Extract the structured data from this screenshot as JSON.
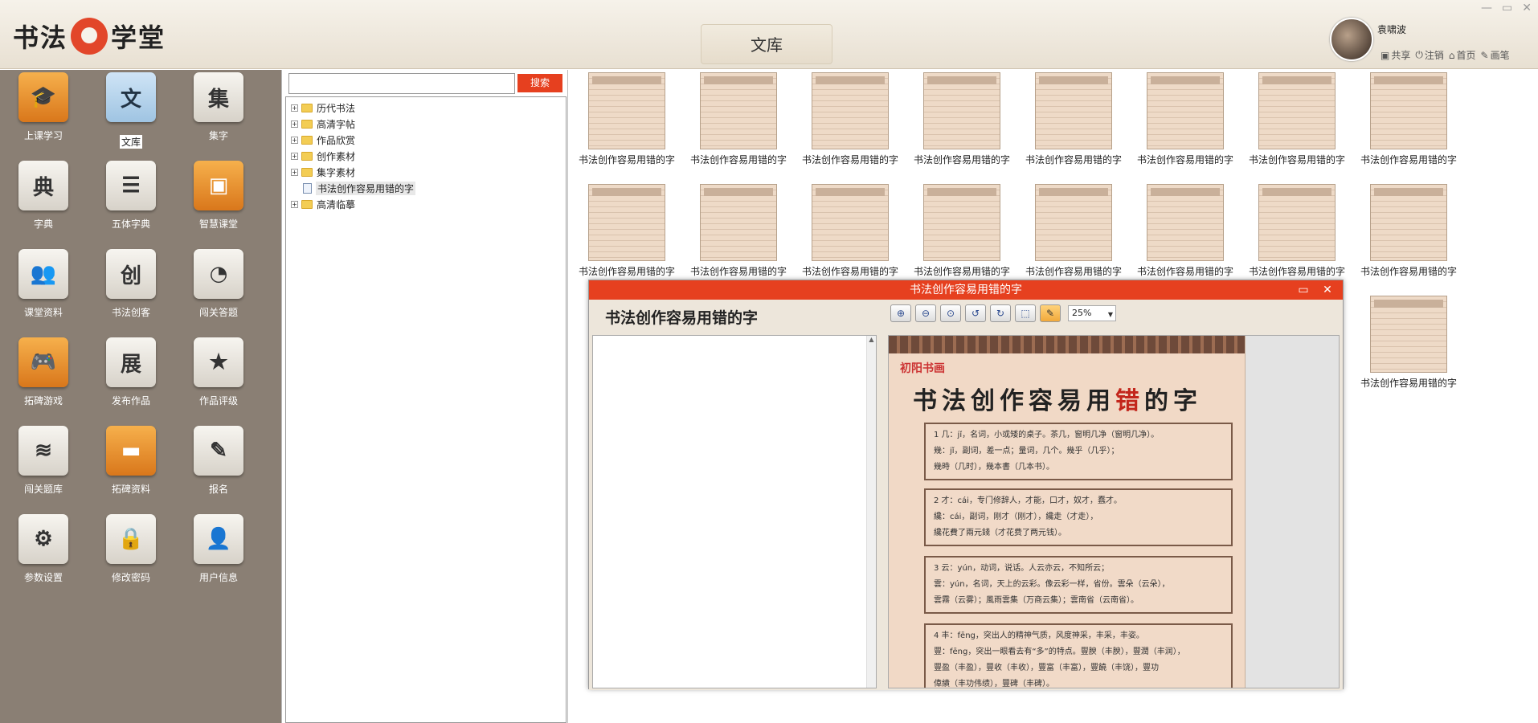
{
  "app": {
    "logo_text_left": "书法",
    "logo_text_right": "学堂",
    "page_title": "文库",
    "window_controls": [
      "—",
      "▭",
      "✕"
    ]
  },
  "user": {
    "name": "袁啸波",
    "actions": [
      {
        "icon": "image-icon",
        "label": "共享"
      },
      {
        "icon": "power-icon",
        "label": "注销"
      },
      {
        "icon": "home-icon",
        "label": "首页"
      },
      {
        "icon": "pen-icon",
        "label": "画笔"
      }
    ]
  },
  "nav": [
    {
      "label": "上课学习",
      "glyph": "🎓",
      "style": "orange"
    },
    {
      "label": "文库",
      "glyph": "文",
      "style": "blue",
      "selected": true
    },
    {
      "label": "集字",
      "glyph": "集",
      "style": "gray"
    },
    {
      "label": "字典",
      "glyph": "典",
      "style": "gray"
    },
    {
      "label": "五体字典",
      "glyph": "☰",
      "style": "gray"
    },
    {
      "label": "智慧课堂",
      "glyph": "▣",
      "style": "orange"
    },
    {
      "label": "课堂资料",
      "glyph": "👥",
      "style": "gray"
    },
    {
      "label": "书法创客",
      "glyph": "创",
      "style": "gray"
    },
    {
      "label": "闯关答题",
      "glyph": "◔",
      "style": "gray"
    },
    {
      "label": "拓碑游戏",
      "glyph": "🎮",
      "style": "orange"
    },
    {
      "label": "发布作品",
      "glyph": "展",
      "style": "gray"
    },
    {
      "label": "作品评级",
      "glyph": "★",
      "style": "gray"
    },
    {
      "label": "闯关题库",
      "glyph": "≋",
      "style": "gray"
    },
    {
      "label": "拓碑资料",
      "glyph": "▬",
      "style": "orange"
    },
    {
      "label": "报名",
      "glyph": "✎",
      "style": "gray"
    },
    {
      "label": "参数设置",
      "glyph": "⚙",
      "style": "gray"
    },
    {
      "label": "修改密码",
      "glyph": "🔒",
      "style": "gray"
    },
    {
      "label": "用户信息",
      "glyph": "👤",
      "style": "gray"
    }
  ],
  "search": {
    "value": "",
    "button_label": "搜索"
  },
  "tree": [
    {
      "label": "历代书法",
      "type": "folder"
    },
    {
      "label": "高清字帖",
      "type": "folder"
    },
    {
      "label": "作品欣赏",
      "type": "folder"
    },
    {
      "label": "创作素材",
      "type": "folder"
    },
    {
      "label": "集字素材",
      "type": "folder"
    },
    {
      "label": "书法创作容易用错的字",
      "type": "doc",
      "selected": true
    },
    {
      "label": "高清临摹",
      "type": "folder"
    }
  ],
  "grid": {
    "caption": "书法创作容易用错的字",
    "visible_count": 17
  },
  "dialog": {
    "title": "书法创作容易用错的字",
    "doc_title": "书法创作容易用错的字",
    "zoom": "25%",
    "toolbar": [
      "zoom-in-icon",
      "zoom-out-icon",
      "zoom-fit-icon",
      "rotate-left-icon",
      "rotate-right-icon",
      "fit-page-icon",
      "pencil-icon"
    ],
    "page": {
      "brand": "初阳书画",
      "heading_prefix": "书法创作容易用",
      "heading_red": "错",
      "heading_suffix": "的字",
      "entries": [
        [
          "1  几：jǐ，名词，小或矮的桌子。茶几，窗明几净（窗明几净）。",
          "幾：jǐ，副词，差一点；量词，几个。幾乎（几乎）；",
          "幾時（几时），幾本書（几本书）。"
        ],
        [
          "2  才：cái，专门修辞人，才能，口才，奴才，蠢才。",
          "纔：cái，副词，刚才（刚才），纔走（才走），",
          "纔花費了兩元錢（才花费了两元钱）。"
        ],
        [
          "3  云：yún，动词，说话。人云亦云，不知所云；",
          "雲：yún，名词，天上的云彩。像云彩一样，省份。雲朵（云朵），",
          "雲霧（云雾）；風雨雲集（万商云集）；雲南省（云南省）。"
        ],
        [
          "4  丰：fēng，突出人的精神气质，风度神采，丰采，丰姿。",
          "豐：fēng，突出一眼看去有“多”的特点。豐腴（丰腴），豐潤（丰润），",
          "豐盈（丰盈），豐收（丰收），豐富（丰富），豐饒（丰饶），豐功",
          "偉績（丰功伟绩），豐碑（丰碑）。"
        ]
      ]
    }
  }
}
